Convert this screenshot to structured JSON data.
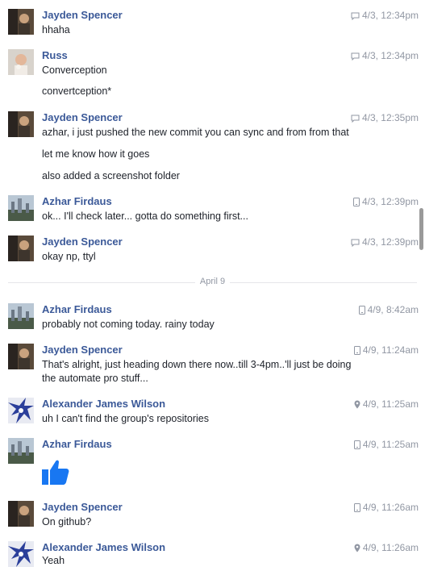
{
  "messages": [
    {
      "name": "Jayden Spencer",
      "time": "4/3, 12:34pm",
      "device": "chat",
      "lines": [
        "hhaha"
      ]
    },
    {
      "name": "Russ",
      "time": "4/3, 12:34pm",
      "device": "chat",
      "lines": [
        "Converception",
        "convertception*"
      ]
    },
    {
      "name": "Jayden Spencer",
      "time": "4/3, 12:35pm",
      "device": "chat",
      "lines": [
        "azhar, i just pushed the new commit you can sync and from from that",
        "let me know how it goes",
        "also added a screenshot folder"
      ]
    },
    {
      "name": "Azhar Firdaus",
      "time": "4/3, 12:39pm",
      "device": "mobile",
      "lines": [
        "ok... I'll check later... gotta do something first..."
      ]
    },
    {
      "name": "Jayden Spencer",
      "time": "4/3, 12:39pm",
      "device": "chat",
      "lines": [
        "okay np, ttyl"
      ]
    },
    {
      "name": "Azhar Firdaus",
      "time": "4/9, 8:42am",
      "device": "mobile",
      "lines": [
        "probably not coming today. rainy today"
      ]
    },
    {
      "name": "Jayden Spencer",
      "time": "4/9, 11:24am",
      "device": "mobile",
      "lines": [
        "That's alright, just heading down there now..till 3-4pm..'ll just be doing",
        "the automate pro stuff..."
      ]
    },
    {
      "name": "Alexander James Wilson",
      "time": "4/9, 11:25am",
      "device": "location",
      "lines": [
        "uh I can't find the group's repositories"
      ]
    },
    {
      "name": "Azhar Firdaus",
      "time": "4/9, 11:25am",
      "device": "mobile",
      "lines": [],
      "sticker": "thumbs-up"
    },
    {
      "name": "Jayden Spencer",
      "time": "4/9, 11:26am",
      "device": "mobile",
      "lines": [
        "On github?"
      ]
    },
    {
      "name": "Alexander James Wilson",
      "time": "4/9, 11:26am",
      "device": "location",
      "lines": [
        "Yeah"
      ]
    }
  ],
  "date_divider": "April 9",
  "colors": {
    "name": "#3b5998",
    "meta": "#9197a3",
    "like": "#1877f2"
  }
}
